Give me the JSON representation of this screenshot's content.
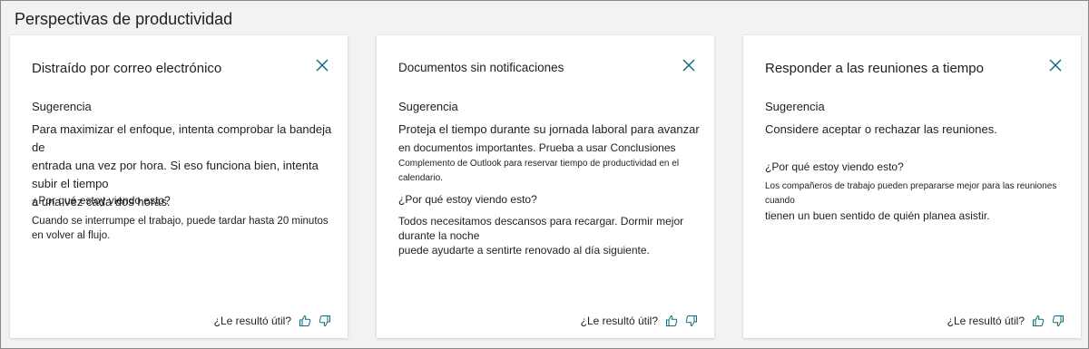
{
  "section": {
    "title": "Perspectivas de productividad"
  },
  "accent_color": "#0e6d7a",
  "cards": [
    {
      "title": "Distraído por correo electrónico",
      "suggestion_label": "Sugerencia",
      "suggestion_lines": [
        "Para maximizar el enfoque, intenta comprobar la bandeja de",
        "entrada una vez por hora. Si eso funciona bien, intenta subir el tiempo",
        "a una vez cada dos horas."
      ],
      "why_label": "¿Por qué estoy viendo esto?",
      "why_lines": [
        "Cuando se interrumpe el trabajo, puede tardar hasta 20 minutos",
        "en volver al flujo."
      ],
      "feedback_label": "¿Le resultó útil?"
    },
    {
      "title": "Documentos sin notificaciones",
      "suggestion_label": "Sugerencia",
      "suggestion_lines": [
        "Proteja el tiempo durante su jornada laboral para avanzar",
        "en documentos importantes. Prueba a usar Conclusiones",
        "Complemento de Outlook para reservar tiempo de productividad en el calendario."
      ],
      "why_label": "¿Por qué estoy viendo esto?",
      "why_lines": [
        "Todos necesitamos descansos para recargar. Dormir mejor durante la noche",
        "puede ayudarte a sentirte renovado al día siguiente."
      ],
      "feedback_label": "¿Le resultó útil?"
    },
    {
      "title": "Responder a las reuniones a tiempo",
      "suggestion_label": "Sugerencia",
      "suggestion_lines": [
        "Considere aceptar o rechazar las reuniones."
      ],
      "why_label": "¿Por qué estoy viendo esto?",
      "why_lines": [
        "Los compañeros de trabajo pueden prepararse mejor para las reuniones cuando",
        "tienen un buen sentido de quién planea asistir."
      ],
      "feedback_label": "¿Le resultó útil?"
    }
  ]
}
